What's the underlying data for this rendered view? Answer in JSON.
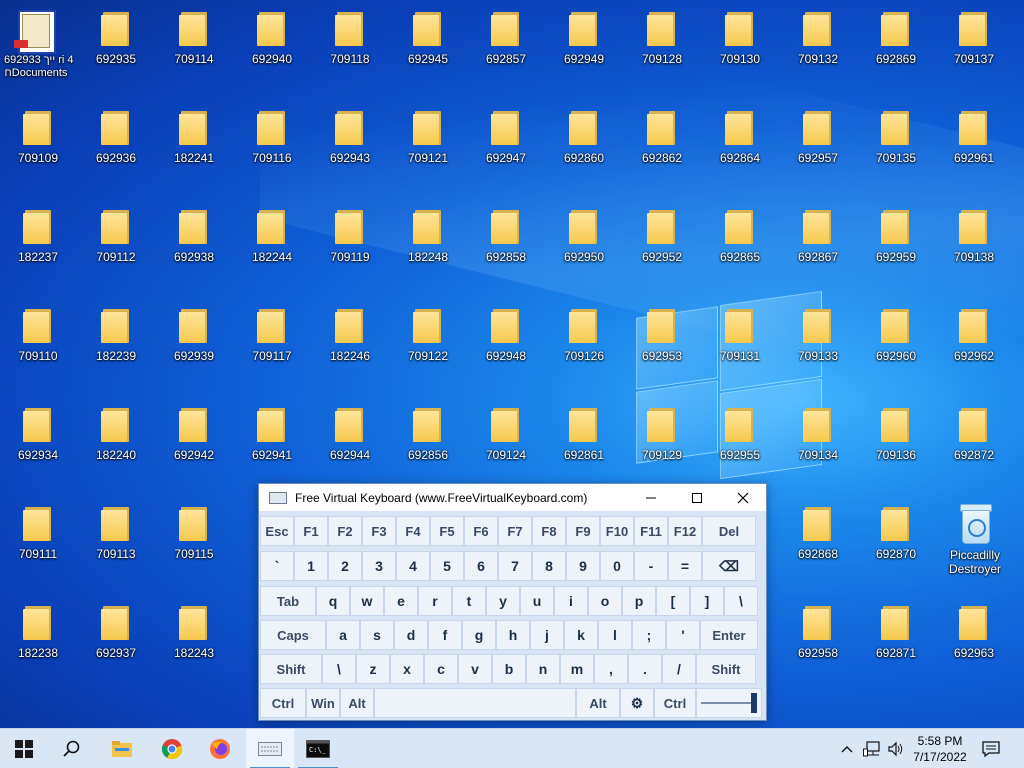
{
  "desktop": {
    "first_icon_label_lines": [
      "ייך 692933 ri 4",
      "חDocuments"
    ],
    "grid": [
      [
        "",
        "692935",
        "709114",
        "692940",
        "709118",
        "692945",
        "692857",
        "692949",
        "709128",
        "709130",
        "709132",
        "692869",
        "709137"
      ],
      [
        "709109",
        "692936",
        "182241",
        "709116",
        "692943",
        "709121",
        "692947",
        "692860",
        "692862",
        "692864",
        "692957",
        "709135",
        "692961"
      ],
      [
        "182237",
        "709112",
        "692938",
        "182244",
        "709119",
        "182248",
        "692858",
        "692950",
        "692952",
        "692865",
        "692867",
        "692959",
        "709138"
      ],
      [
        "709110",
        "182239",
        "692939",
        "709117",
        "182246",
        "709122",
        "692948",
        "709126",
        "692953",
        "709131",
        "709133",
        "692960",
        "692962"
      ],
      [
        "692934",
        "182240",
        "692942",
        "692941",
        "692944",
        "692856",
        "709124",
        "692861",
        "709129",
        "692955",
        "709134",
        "709136",
        "692872"
      ],
      [
        "709111",
        "709113",
        "709115",
        "",
        "",
        "",
        "",
        "",
        "",
        "",
        "692868",
        "692870",
        ""
      ],
      [
        "182238",
        "692937",
        "182243",
        "",
        "",
        "",
        "",
        "",
        "",
        "",
        "692958",
        "692871",
        "692963"
      ]
    ],
    "recycle_bin_label_lines": [
      "Piccadilly",
      "Destroyer"
    ]
  },
  "keyboard": {
    "title": "Free Virtual Keyboard (www.FreeVirtualKeyboard.com)",
    "minimize_icon": "minimize-icon",
    "maximize_icon": "maximize-icon",
    "close_icon": "close-icon",
    "rows": [
      [
        "Esc",
        "F1",
        "F2",
        "F3",
        "F4",
        "F5",
        "F6",
        "F7",
        "F8",
        "F9",
        "F10",
        "F11",
        "F12",
        "Del"
      ],
      [
        "`",
        "1",
        "2",
        "3",
        "4",
        "5",
        "6",
        "7",
        "8",
        "9",
        "0",
        "-",
        "=",
        "⌫"
      ],
      [
        "Tab",
        "q",
        "w",
        "e",
        "r",
        "t",
        "y",
        "u",
        "i",
        "o",
        "p",
        "[",
        "]",
        "\\"
      ],
      [
        "Caps",
        "a",
        "s",
        "d",
        "f",
        "g",
        "h",
        "j",
        "k",
        "l",
        ";",
        "'",
        "Enter"
      ],
      [
        "Shift",
        "\\",
        "z",
        "x",
        "c",
        "v",
        "b",
        "n",
        "m",
        ",",
        ".",
        "/",
        "Shift"
      ],
      [
        "Ctrl",
        "Win",
        "Alt",
        "",
        "Alt",
        "⚙",
        "Ctrl",
        ""
      ]
    ]
  },
  "taskbar": {
    "icons": [
      "start-icon",
      "search-icon",
      "file-explorer-icon",
      "chrome-icon",
      "firefox-icon",
      "virtual-keyboard-icon",
      "terminal-icon"
    ],
    "tray": [
      "chevron-up-icon",
      "network-icon",
      "volume-icon"
    ],
    "time": "5:58 PM",
    "date": "7/17/2022",
    "notifications_icon": "notifications-icon"
  }
}
